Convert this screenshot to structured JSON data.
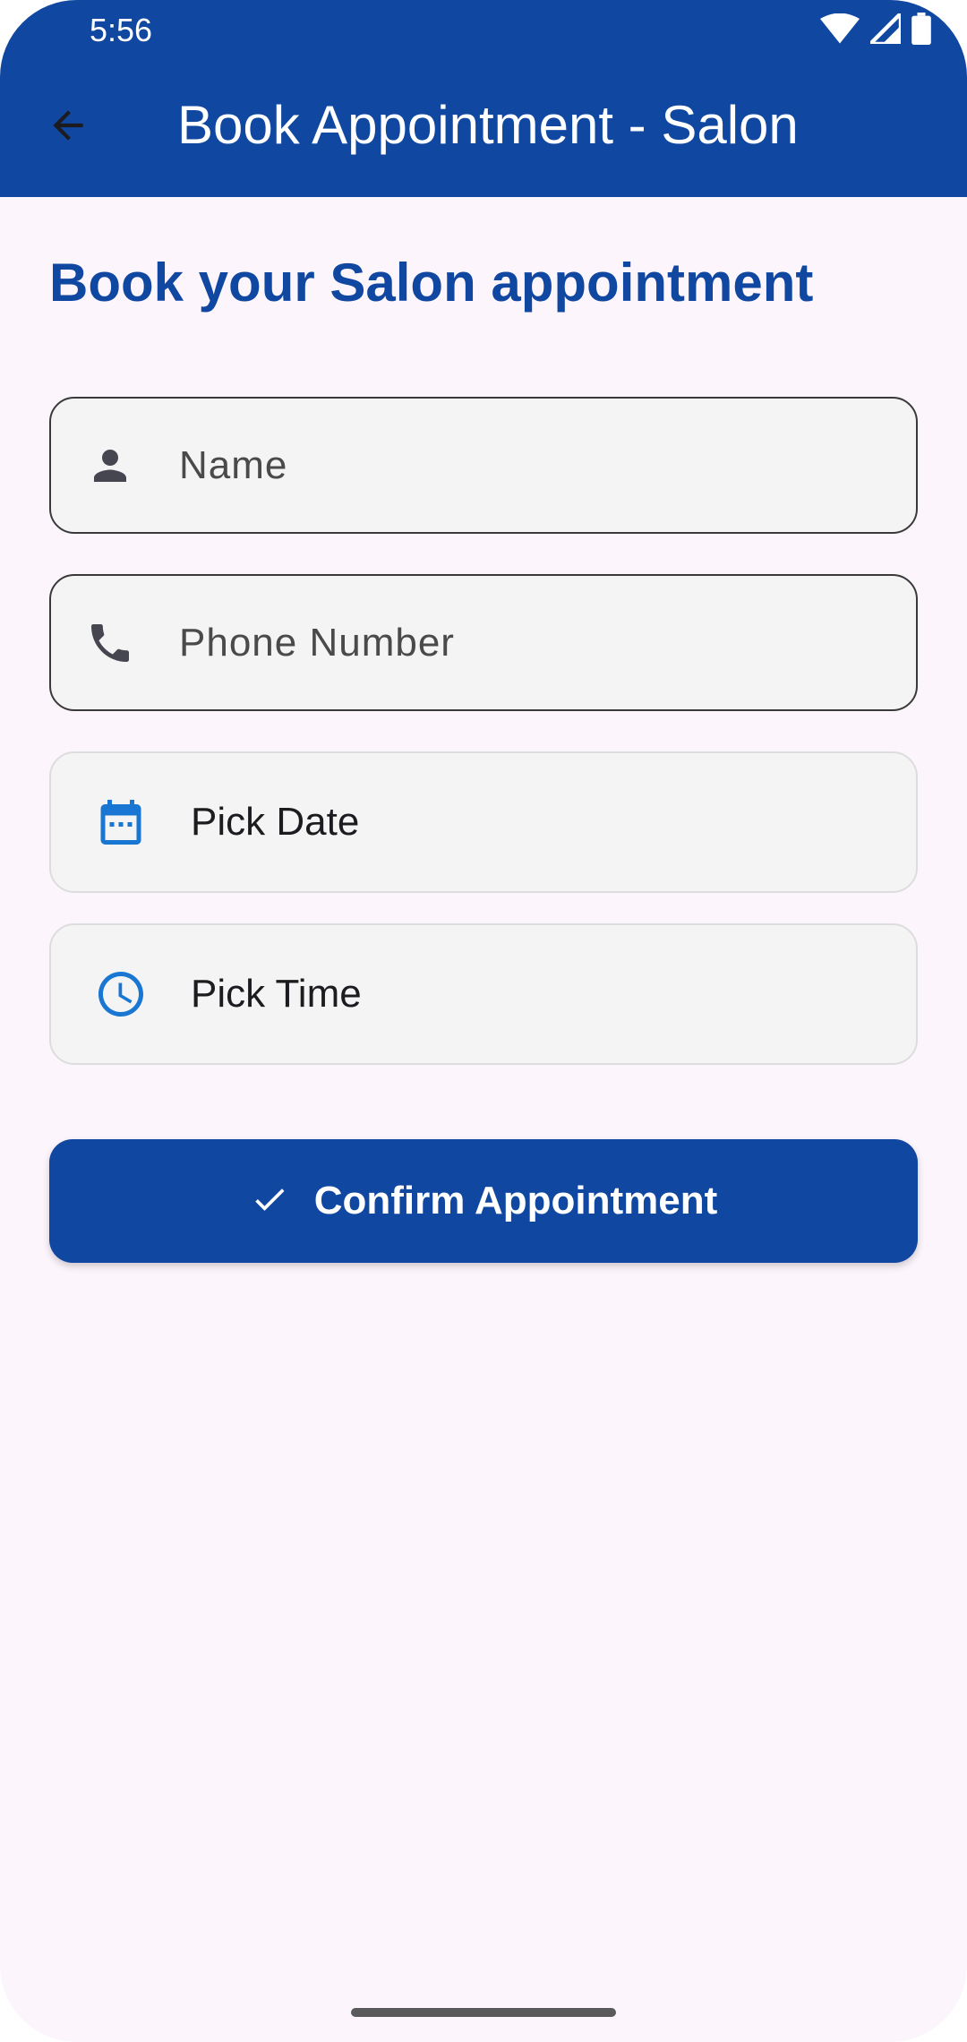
{
  "status_bar": {
    "time": "5:56",
    "icons": [
      "wifi-icon",
      "signal-icon",
      "battery-icon"
    ]
  },
  "app_bar": {
    "back_icon": "arrow-back-icon",
    "title": "Book Appointment - Salon"
  },
  "main": {
    "heading": "Book your Salon appointment",
    "name_field": {
      "placeholder": "Name",
      "icon": "person-icon"
    },
    "phone_field": {
      "placeholder": "Phone Number",
      "icon": "phone-icon"
    },
    "date_picker": {
      "label": "Pick Date",
      "icon": "calendar-icon"
    },
    "time_picker": {
      "label": "Pick Time",
      "icon": "clock-icon"
    },
    "confirm_button": {
      "label": "Confirm Appointment",
      "icon": "check-icon"
    }
  },
  "colors": {
    "primary": "#0f47a1",
    "background": "#fcf5fc",
    "field_background": "#f4f4f4",
    "picker_icon": "#1976d2"
  }
}
